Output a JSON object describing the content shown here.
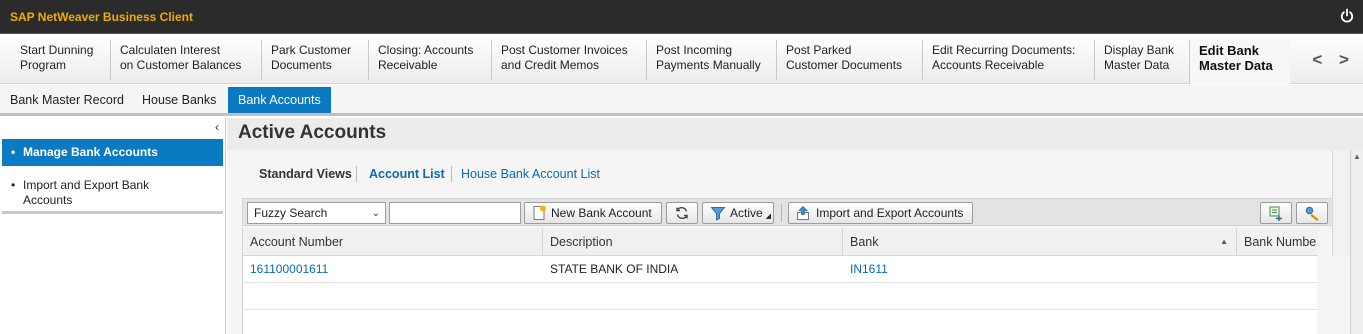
{
  "window": {
    "title": "SAP NetWeaver Business Client",
    "power_icon": "power-icon"
  },
  "launch_tabs": [
    {
      "line1": "Start Dunning",
      "line2": "Program"
    },
    {
      "line1": "Calculaten Interest",
      "line2": "on Customer Balances"
    },
    {
      "line1": "Park Customer",
      "line2": "Documents"
    },
    {
      "line1": "Closing: Accounts",
      "line2": "Receivable"
    },
    {
      "line1": "Post Customer Invoices",
      "line2": "and Credit Memos"
    },
    {
      "line1": "Post Incoming",
      "line2": "Payments Manually"
    },
    {
      "line1": "Post Parked",
      "line2": "Customer Documents"
    },
    {
      "line1": "Edit Recurring Documents:",
      "line2": "Accounts Receivable"
    },
    {
      "line1": "Display Bank",
      "line2": "Master Data"
    },
    {
      "line1": "Edit Bank",
      "line2": "Master Data",
      "active": true
    }
  ],
  "nav_arrows": "< >",
  "sub_tabs": [
    {
      "label": "Bank Master Record"
    },
    {
      "label": "House Banks"
    },
    {
      "label": "Bank Accounts",
      "active": true
    }
  ],
  "sidebar": {
    "collapse_icon": "‹",
    "items": [
      {
        "label": "Manage Bank Accounts",
        "selected": true
      },
      {
        "line1": "Import and Export Bank",
        "line2": "Accounts"
      }
    ]
  },
  "main": {
    "title": "Active Accounts",
    "views": {
      "label": "Standard Views",
      "links": [
        "Account List",
        "House Bank Account List"
      ]
    },
    "toolbar": {
      "search_select": "Fuzzy Search",
      "search_value": "",
      "new_button": "New Bank Account",
      "filter_button": "Active",
      "import_export_button": "Import and Export Accounts"
    },
    "table": {
      "columns": [
        "Account Number",
        "Description",
        "Bank",
        "Bank Numbe"
      ],
      "rows": [
        {
          "account_number": "161100001611",
          "description": "STATE BANK OF INDIA",
          "bank": "IN1611"
        }
      ]
    }
  },
  "colors": {
    "accent": "#0a7bc2",
    "title_text": "#f0ab00",
    "titlebar_bg": "#2b2b2b",
    "link": "#0a6ab0"
  }
}
